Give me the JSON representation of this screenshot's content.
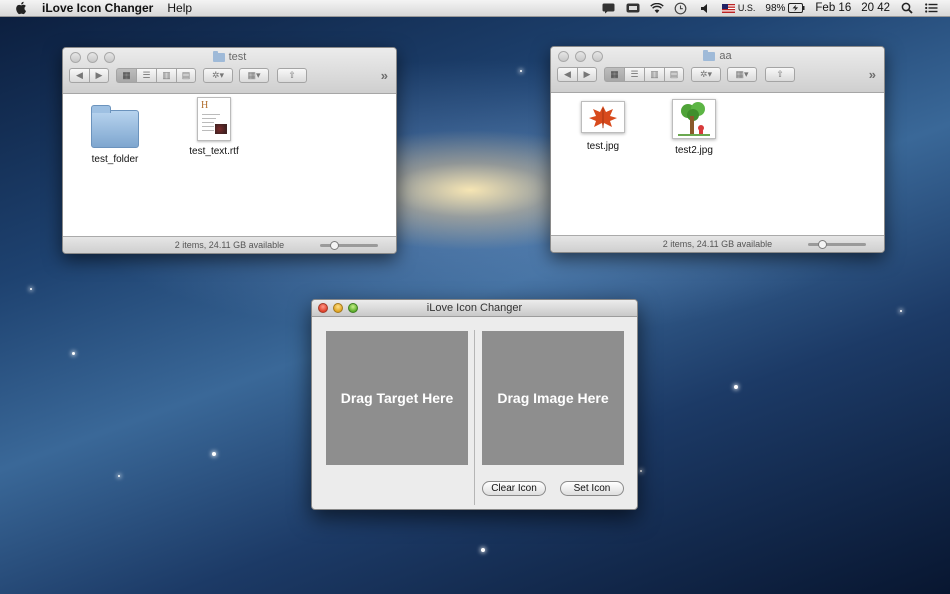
{
  "menubar": {
    "app_name": "iLove Icon Changer",
    "menus": [
      "Help"
    ],
    "input_source": "U.S.",
    "battery": "98%",
    "date": "Feb 16",
    "time": "20 42"
  },
  "finder_left": {
    "title": "test",
    "items": [
      {
        "label": "test_folder",
        "kind": "folder-icon"
      },
      {
        "label": "test_text.rtf",
        "kind": "document-icon"
      }
    ],
    "status": "2 items, 24.11 GB available"
  },
  "finder_right": {
    "title": "aa",
    "items": [
      {
        "label": "test.jpg",
        "kind": "image-thumbnail-leaf"
      },
      {
        "label": "test2.jpg",
        "kind": "image-thumbnail-tree"
      }
    ],
    "status": "2 items, 24.11 GB available"
  },
  "app": {
    "title": "iLove Icon Changer",
    "target_drop": "Drag Target Here",
    "image_drop": "Drag Image Here",
    "clear_button": "Clear Icon",
    "set_button": "Set Icon"
  },
  "colors": {
    "drop_zone": "#8e8e8e",
    "window_bg": "#ececec"
  }
}
